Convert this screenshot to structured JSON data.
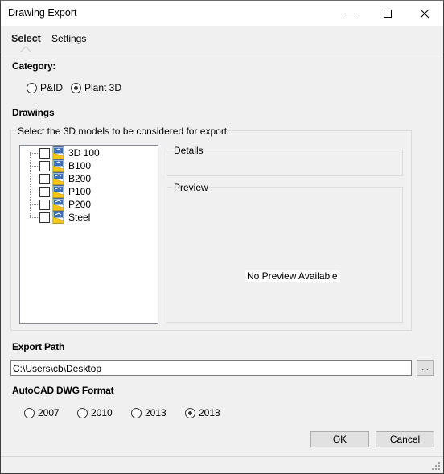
{
  "window": {
    "title": "Drawing Export",
    "minimize_icon": "minimize-icon",
    "maximize_icon": "maximize-icon",
    "close_icon": "close-icon"
  },
  "tabs": [
    {
      "label": "Select",
      "active": true
    },
    {
      "label": "Settings",
      "active": false
    }
  ],
  "category": {
    "label": "Category:",
    "options": [
      {
        "label": "P&ID",
        "checked": false
      },
      {
        "label": "Plant 3D",
        "checked": true
      }
    ]
  },
  "drawings": {
    "label": "Drawings",
    "group_label": "Select the 3D models to be considered for export",
    "items": [
      {
        "label": "3D 100",
        "checked": false,
        "icon": "plant3d-drawing-icon"
      },
      {
        "label": "B100",
        "checked": false,
        "icon": "plant3d-drawing-icon"
      },
      {
        "label": "B200",
        "checked": false,
        "icon": "plant3d-drawing-icon"
      },
      {
        "label": "P100",
        "checked": false,
        "icon": "plant3d-drawing-icon"
      },
      {
        "label": "P200",
        "checked": false,
        "icon": "plant3d-drawing-icon"
      },
      {
        "label": "Steel",
        "checked": false,
        "icon": "plant3d-drawing-icon"
      }
    ],
    "details_label": "Details",
    "preview_label": "Preview",
    "no_preview_text": "No Preview Available"
  },
  "export_path": {
    "label": "Export Path",
    "value": "C:\\Users\\cb\\Desktop",
    "browse_label": "..."
  },
  "dwg_format": {
    "label": "AutoCAD DWG Format",
    "options": [
      {
        "label": "2007",
        "checked": false
      },
      {
        "label": "2010",
        "checked": false
      },
      {
        "label": "2013",
        "checked": false
      },
      {
        "label": "2018",
        "checked": true
      }
    ]
  },
  "buttons": {
    "ok": "OK",
    "cancel": "Cancel"
  }
}
